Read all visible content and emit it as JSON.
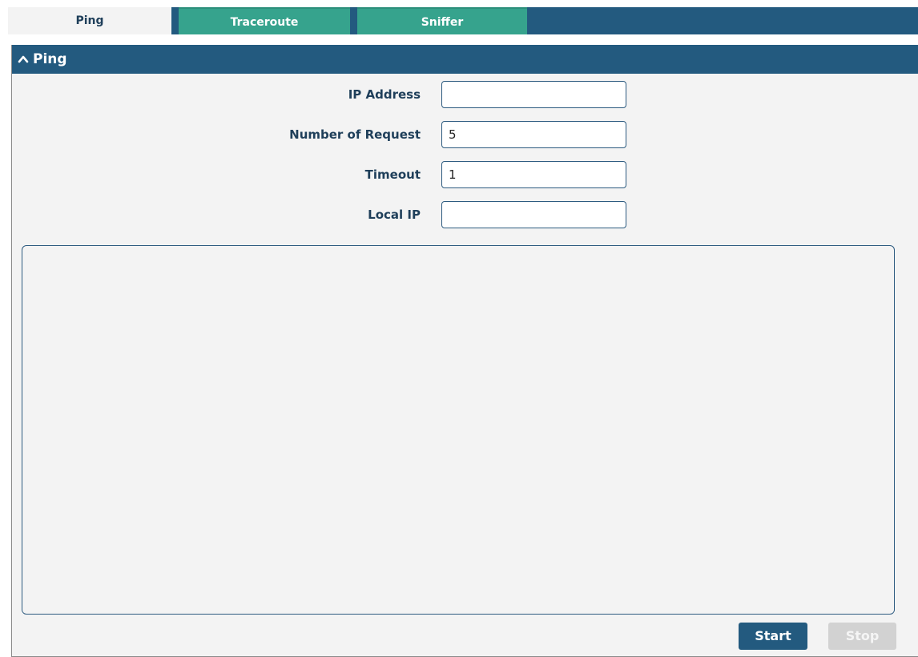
{
  "tabs": [
    {
      "label": "Ping",
      "active": true
    },
    {
      "label": "Traceroute",
      "active": false
    },
    {
      "label": "Sniffer",
      "active": false
    }
  ],
  "panel": {
    "title": "Ping",
    "icon": "chevron-up-icon"
  },
  "fields": {
    "ip_address": {
      "label": "IP Address",
      "value": ""
    },
    "number_of_request": {
      "label": "Number of Request",
      "value": "5"
    },
    "timeout": {
      "label": "Timeout",
      "value": "1"
    },
    "local_ip": {
      "label": "Local IP",
      "value": ""
    }
  },
  "output": {
    "text": ""
  },
  "buttons": {
    "start_label": "Start",
    "stop_label": "Stop",
    "stop_enabled": false
  },
  "colors": {
    "header": "#235a7f",
    "tab_inactive": "#36a38d",
    "panel_bg": "#f3f3f3",
    "button_disabled": "#d2d2d2"
  }
}
